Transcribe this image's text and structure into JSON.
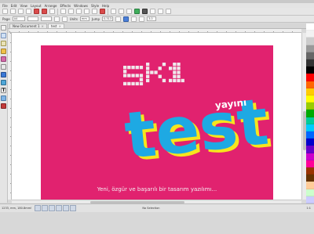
{
  "menu": [
    "File",
    "Edit",
    "View",
    "Layout",
    "Arrange",
    "Effects",
    "Windows",
    "Style",
    "Help"
  ],
  "controls": {
    "page_label": "Page",
    "page_value": "A4",
    "units_label": "Units",
    "units_value": "mm",
    "jump_label": "Jump",
    "jump_value": "0.313",
    "size_value": "3.0"
  },
  "tabs": [
    {
      "label": "New Document 1",
      "active": false
    },
    {
      "label": "test",
      "active": true
    }
  ],
  "canvas": {
    "logo_text": "sK1",
    "badge_text": "yayını",
    "title_text": "test",
    "tagline": "Yeni, özgür ve başarılı bir tasarım yazılımı...",
    "colors": {
      "page": "#e1226f",
      "logo": "#efe9ec",
      "title": "#1ea9e3",
      "title_shadow": "#f6e61d",
      "tagline": "#f3eef2"
    }
  },
  "status": {
    "coords": "1233, mm, 180.8mm!",
    "message": "No Selection",
    "zoom": "1:1"
  },
  "palette_colors": [
    "#ffffff",
    "#f2f2f2",
    "#cccccc",
    "#999999",
    "#666666",
    "#333333",
    "#000000",
    "#ff0000",
    "#ff6600",
    "#ffcc00",
    "#ffff00",
    "#99cc00",
    "#00aa00",
    "#00cc99",
    "#00ccff",
    "#0066ff",
    "#0000cc",
    "#6600cc",
    "#cc00cc",
    "#ff0099",
    "#993300",
    "#663300",
    "#ffcc99",
    "#ccffcc",
    "#ccccff"
  ]
}
